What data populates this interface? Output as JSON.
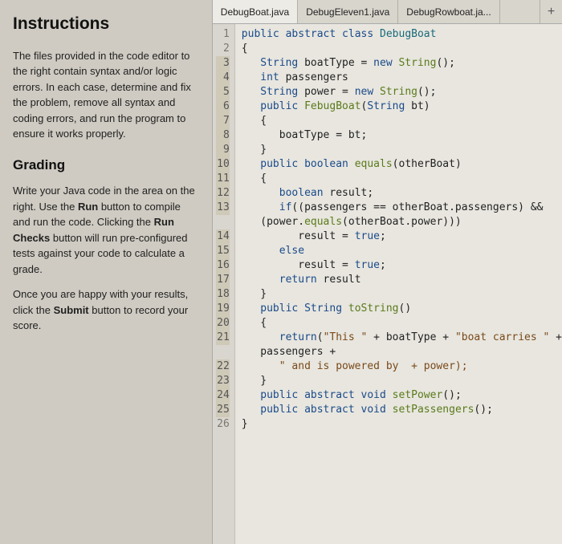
{
  "instructions": {
    "title": "Instructions",
    "para1_prefix": "The files provided in the code editor to the right contain syntax and/or logic errors. In each case, determine and fix the problem, remove all syntax and coding errors, and run the program to ensure it works properly.",
    "grading_title": "Grading",
    "para2_a": "Write your Java code in the area on the right. Use the ",
    "para2_b_run": "Run",
    "para2_c": " button to compile and run the code. Clicking the ",
    "para2_d_runchecks": "Run Checks",
    "para2_e": " button will run pre-configured tests against your code to calculate a grade.",
    "para3_a": "Once you are happy with your results, click the ",
    "para3_b_submit": "Submit",
    "para3_c": " button to record your score."
  },
  "tabs": [
    {
      "label": "DebugBoat.java",
      "active": true
    },
    {
      "label": "DebugEleven1.java",
      "active": false
    },
    {
      "label": "DebugRowboat.ja...",
      "active": false
    }
  ],
  "add_tab": "+",
  "code": {
    "lines": [
      {
        "n": 1,
        "hl": false,
        "html": "<span class='kw'>public</span> <span class='kw'>abstract</span> <span class='kw'>class</span> <span class='cls'>DebugBoat</span>"
      },
      {
        "n": 2,
        "hl": false,
        "html": "{"
      },
      {
        "n": 3,
        "hl": true,
        "html": "   <span class='type'>String</span> boatType = <span class='kw'>new</span> <span class='fn'>String</span>();"
      },
      {
        "n": 4,
        "hl": true,
        "html": "   <span class='kw'>int</span> passengers"
      },
      {
        "n": 5,
        "hl": true,
        "html": "   <span class='type'>String</span> power = <span class='kw'>new</span> <span class='fn'>String</span>();"
      },
      {
        "n": 6,
        "hl": true,
        "html": "   <span class='kw'>public</span> <span class='fn'>FebugBoat</span>(<span class='type'>String</span> bt)"
      },
      {
        "n": 7,
        "hl": true,
        "html": "   {"
      },
      {
        "n": 8,
        "hl": true,
        "html": "      boatType = bt;"
      },
      {
        "n": 9,
        "hl": true,
        "html": "   }"
      },
      {
        "n": 10,
        "hl": true,
        "html": "   <span class='kw'>public</span> <span class='kw'>boolean</span> <span class='fn'>equals</span>(otherBoat)"
      },
      {
        "n": 11,
        "hl": true,
        "html": "   {"
      },
      {
        "n": 12,
        "hl": true,
        "html": "      <span class='kw'>boolean</span> result;"
      },
      {
        "n": 13,
        "hl": true,
        "html": "      <span class='kw'>if</span>((passengers == otherBoat.passengers) &amp;&amp;"
      },
      {
        "n": 0,
        "hl": false,
        "html": "   (power.<span class='fn'>equals</span>(otherBoat.power)))"
      },
      {
        "n": 14,
        "hl": true,
        "html": "         result = <span class='kw'>true</span>;"
      },
      {
        "n": 15,
        "hl": true,
        "html": "      <span class='kw'>else</span>"
      },
      {
        "n": 16,
        "hl": true,
        "html": "         result = <span class='kw'>true</span>;"
      },
      {
        "n": 17,
        "hl": true,
        "html": "      <span class='kw'>return</span> result"
      },
      {
        "n": 18,
        "hl": true,
        "html": "   }"
      },
      {
        "n": 19,
        "hl": true,
        "html": "   <span class='kw'>public</span> <span class='type'>String</span> <span class='fn'>toString</span>()"
      },
      {
        "n": 20,
        "hl": true,
        "html": "   {"
      },
      {
        "n": 21,
        "hl": true,
        "html": "      <span class='kw'>return</span>(<span class='str'>\"This \"</span> + boatType + <span class='str'>\"boat carries \"</span> +"
      },
      {
        "n": 0,
        "hl": false,
        "html": "   passengers +"
      },
      {
        "n": 22,
        "hl": true,
        "html": "      <span class='str'>\" and is powered by  + power);</span>"
      },
      {
        "n": 23,
        "hl": true,
        "html": "   }"
      },
      {
        "n": 24,
        "hl": true,
        "html": "   <span class='kw'>public</span> <span class='kw'>abstract</span> <span class='kw'>void</span> <span class='fn'>setPower</span>();"
      },
      {
        "n": 25,
        "hl": true,
        "html": "   <span class='kw'>public</span> <span class='kw'>abstract</span> <span class='kw'>void</span> <span class='fn'>setPassengers</span>();"
      },
      {
        "n": 26,
        "hl": false,
        "html": "}"
      }
    ]
  }
}
